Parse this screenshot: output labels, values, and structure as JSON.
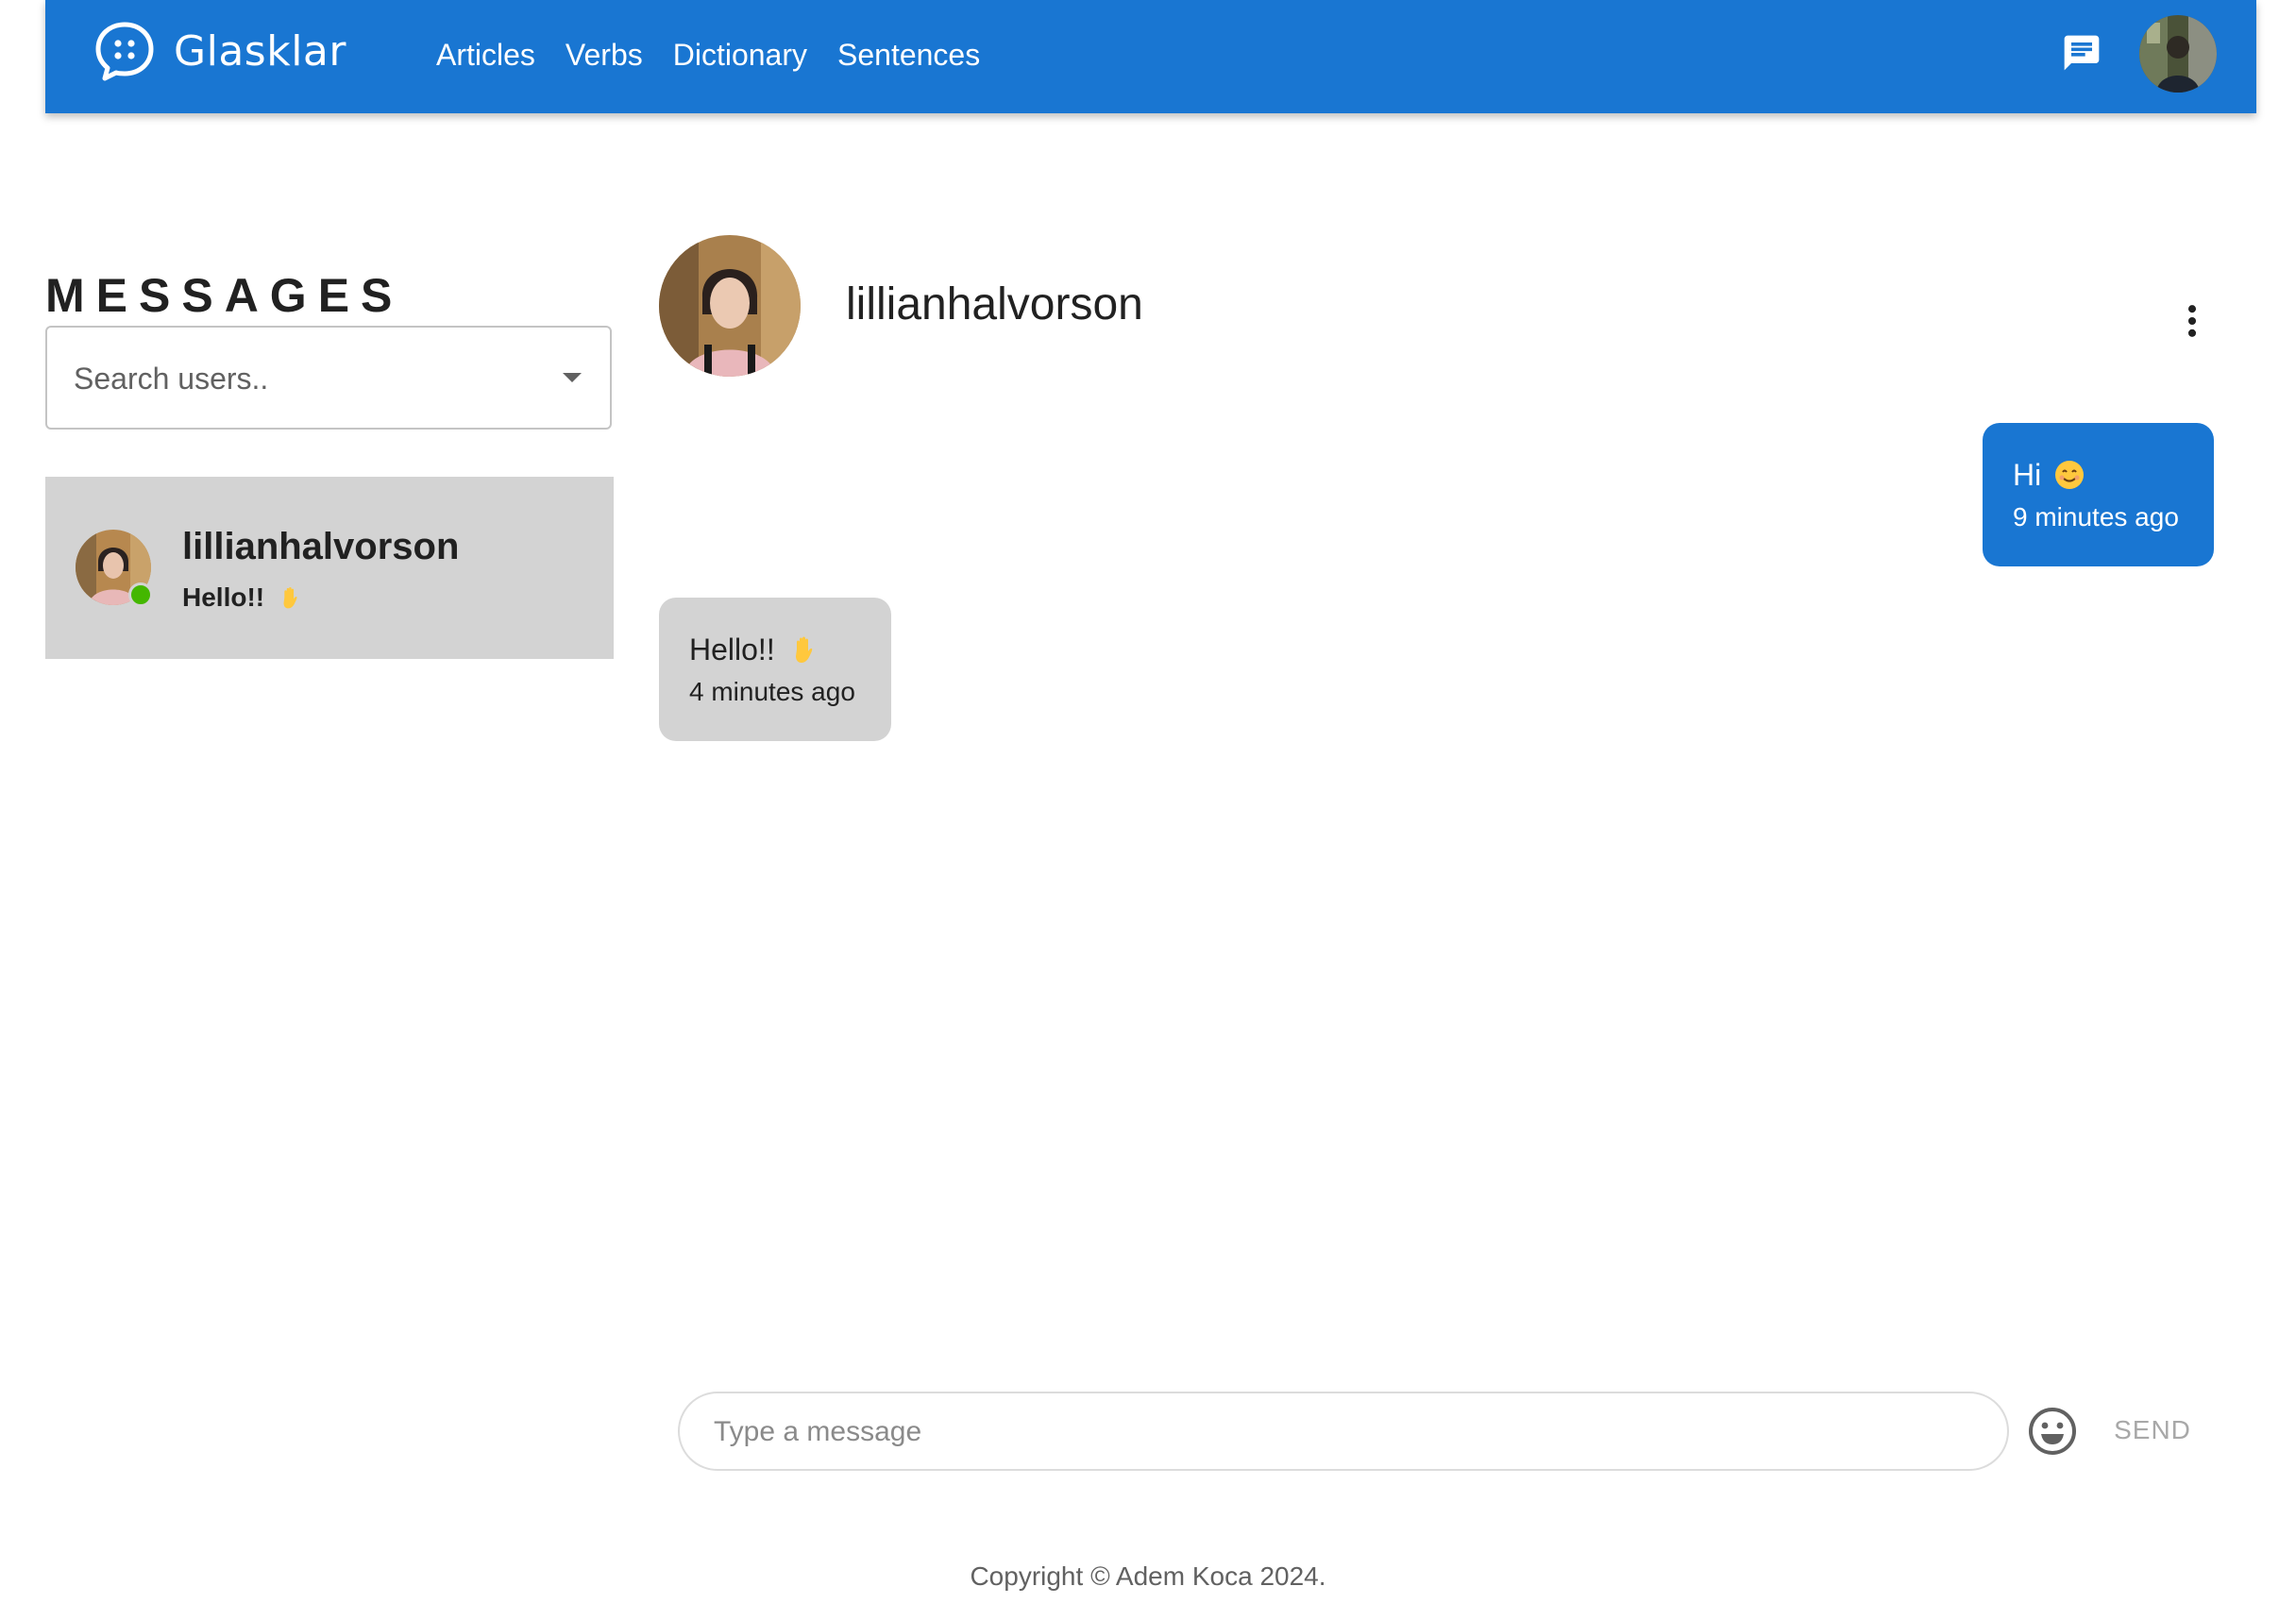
{
  "app": {
    "brand": "Glasklar",
    "nav": [
      "Articles",
      "Verbs",
      "Dictionary",
      "Sentences"
    ],
    "brand_color": "#1976d2"
  },
  "icons": {
    "logo": "chat-bubble-dots-icon",
    "messages": "message-icon",
    "more": "more-vert-icon",
    "emoji_picker": "smiley-icon",
    "dropdown": "arrow-drop-down-icon"
  },
  "sidebar": {
    "title": "MESSAGES",
    "search_placeholder": "Search users..",
    "conversations": [
      {
        "username": "lillianhalvorson",
        "preview": "Hello!!",
        "preview_emoji": "✋",
        "online": true,
        "status_color": "#44b700"
      }
    ]
  },
  "chat": {
    "username": "lillianhalvorson",
    "messages": [
      {
        "direction": "outgoing",
        "text": "Hi",
        "emoji": "😊",
        "time": "9 minutes ago"
      },
      {
        "direction": "incoming",
        "text": "Hello!!",
        "emoji": "✋",
        "time": "4 minutes ago"
      }
    ],
    "composer_placeholder": "Type a message",
    "send_label": "SEND"
  },
  "footer": {
    "copyright": "Copyright © Adem Koca 2024."
  }
}
